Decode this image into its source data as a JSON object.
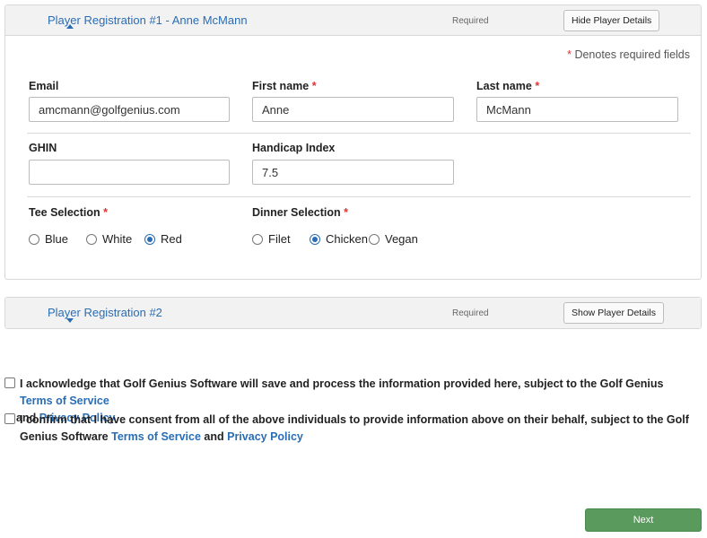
{
  "player1": {
    "title": "Player Registration #1 - Anne McMann",
    "required_label": "Required",
    "toggle_button": "Hide Player Details",
    "denotes_star": "*",
    "denotes_text": "Denotes required fields",
    "email": {
      "label": "Email",
      "value": "amcmann@golfgenius.com"
    },
    "first_name": {
      "label": "First name",
      "required": "*",
      "value": "Anne"
    },
    "last_name": {
      "label": "Last name",
      "required": "*",
      "value": "McMann"
    },
    "ghin": {
      "label": "GHIN",
      "value": ""
    },
    "handicap": {
      "label": "Handicap Index",
      "value": "7.5"
    },
    "tee": {
      "label": "Tee Selection",
      "required": "*",
      "options": [
        "Blue",
        "White",
        "Red"
      ],
      "selected": "Red"
    },
    "dinner": {
      "label": "Dinner Selection",
      "required": "*",
      "options": [
        "Filet",
        "Chicken",
        "Vegan"
      ],
      "selected": "Chicken"
    }
  },
  "player2": {
    "title": "Player Registration #2",
    "required_label": "Required",
    "toggle_button": "Show Player Details"
  },
  "consent": {
    "ack_prefix": "I acknowledge that Golf Genius Software will save and process the information provided here, subject to the Golf Genius ",
    "ack_link1": "Terms of Service",
    "ack_and": " and ",
    "ack_link2": "Privacy Policy",
    "confirm_prefix": "I confirm that I have consent from all of the above individuals to provide information above on their behalf, subject to the Golf Genius Software ",
    "confirm_link1": "Terms of Service",
    "confirm_and": " and ",
    "confirm_link2": "Privacy Policy"
  },
  "next_button": "Next",
  "colors": {
    "link": "#2a6db5",
    "required": "#dd3333",
    "next_button": "#5a9a5c"
  }
}
